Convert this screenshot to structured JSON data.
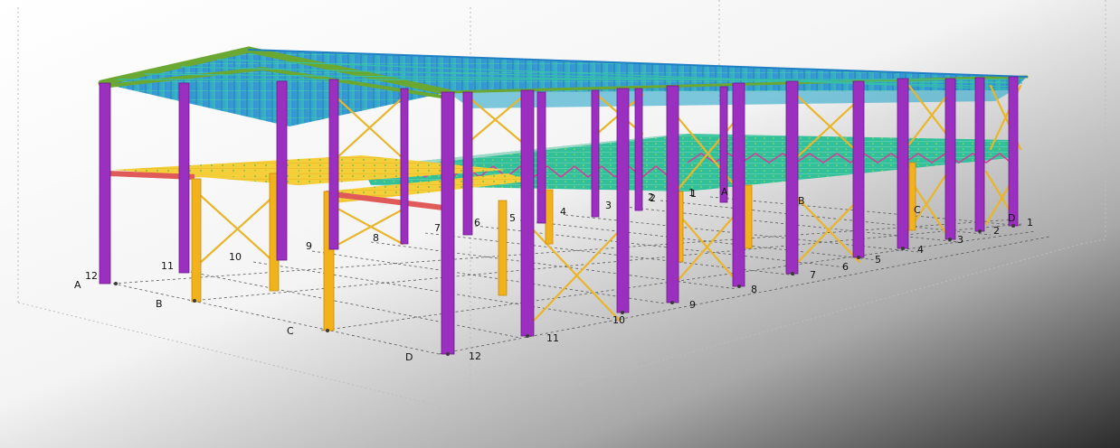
{
  "colors": {
    "background_light": "#ffffff",
    "background_dark": "#2c2c2c",
    "column": "#9a2fc0",
    "column_edge": "#6d1a8c",
    "secondary_column": "#f2b21c",
    "bracing": "#e9b52a",
    "mezzanine_beam": "#f5cf3a",
    "edge_beam_red": "#e05a5a",
    "roof_blue": "#1f7fc4",
    "roof_green": "#6aa832",
    "roof_cyan": "#2fc3b5",
    "deck_green": "#2dbf8a",
    "joist_pink": "#d0409a",
    "grid_line": "#555555",
    "bounding_box": "#9a9a9a"
  },
  "grid_labels": {
    "near_side": [
      {
        "id": "A",
        "text": "A"
      },
      {
        "id": "B",
        "text": "B"
      },
      {
        "id": "C",
        "text": "C"
      },
      {
        "id": "D",
        "text": "D"
      }
    ],
    "front_axis": [
      {
        "id": "12",
        "text": "12"
      },
      {
        "id": "11",
        "text": "11"
      },
      {
        "id": "10",
        "text": "10"
      },
      {
        "id": "9",
        "text": "9"
      },
      {
        "id": "8",
        "text": "8"
      },
      {
        "id": "7",
        "text": "7"
      },
      {
        "id": "6",
        "text": "6"
      },
      {
        "id": "5",
        "text": "5"
      },
      {
        "id": "4",
        "text": "4"
      },
      {
        "id": "3",
        "text": "3"
      },
      {
        "id": "2",
        "text": "2"
      },
      {
        "id": "1",
        "text": "1"
      }
    ],
    "far_side_letters": [
      {
        "id": "A",
        "text": "A"
      },
      {
        "id": "B",
        "text": "B"
      },
      {
        "id": "C",
        "text": "C"
      },
      {
        "id": "D",
        "text": "D"
      }
    ],
    "right_axis": [
      {
        "id": "12",
        "text": "12"
      },
      {
        "id": "11",
        "text": "11"
      },
      {
        "id": "10",
        "text": "10"
      },
      {
        "id": "9",
        "text": "9"
      },
      {
        "id": "8",
        "text": "8"
      },
      {
        "id": "7",
        "text": "7"
      },
      {
        "id": "6",
        "text": "6"
      },
      {
        "id": "5",
        "text": "5"
      },
      {
        "id": "4",
        "text": "4"
      },
      {
        "id": "3",
        "text": "3"
      },
      {
        "id": "2",
        "text": "2"
      },
      {
        "id": "1",
        "text": "1"
      }
    ],
    "inner_numbers": [
      {
        "id": "2",
        "text": "2"
      },
      {
        "id": "1",
        "text": "1"
      }
    ]
  }
}
